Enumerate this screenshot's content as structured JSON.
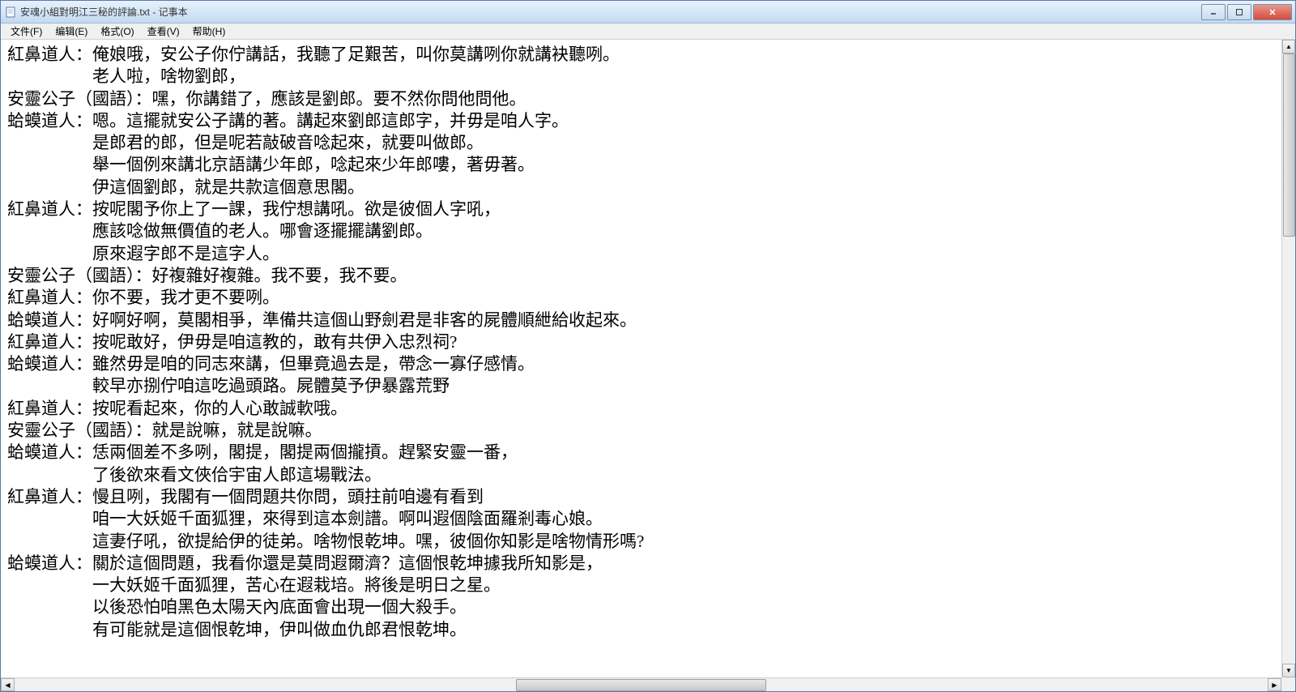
{
  "window": {
    "title": "安魂小組對明江三秘的評論.txt - 记事本"
  },
  "menu": {
    "file": "文件(F)",
    "edit": "编辑(E)",
    "format": "格式(O)",
    "view": "查看(V)",
    "help": "帮助(H)"
  },
  "content": "紅鼻道人：俺娘哦，安公子你佇講話，我聽了足艱苦，叫你莫講咧你就講袂聽咧。\n　　　　　老人啦，啥物劉郎，\n安靈公子（國語）：嘿，你講錯了，應該是劉郎。要不然你問他問他。\n蛤蟆道人：嗯。這擺就安公子講的著。講起來劉郎這郎字，并毋是咱人字。\n　　　　　是郎君的郎，但是呢若敲破音唸起來，就要叫做郎。\n　　　　　舉一個例來講北京語講少年郎，唸起來少年郎嘍，著毋著。\n　　　　　伊這個劉郎，就是共款這個意思閣。\n紅鼻道人：按呢閣予你上了一課，我佇想講吼。欲是彼個人字吼，\n　　　　　應該唸做無價值的老人。哪會逐擺擺講劉郎。\n　　　　　原來遐字郎不是這字人。\n安靈公子（國語）：好複雜好複雜。我不要，我不要。\n紅鼻道人：你不要，我才更不要咧。\n蛤蟆道人：好啊好啊，莫閣相爭，準備共這個山野劍君是非客的屍體順紲給收起來。\n紅鼻道人：按呢敢好，伊毋是咱這教的，敢有共伊入忠烈祠?\n蛤蟆道人：雖然毋是咱的同志來講，但畢竟過去是，帶念一寡仔感情。\n　　　　　較早亦捌佇咱這吃過頭路。屍體莫予伊暴露荒野\n紅鼻道人：按呢看起來，你的人心敢誠軟哦。\n安靈公子（國語）：就是說嘛，就是說嘛。\n蛤蟆道人：恁兩個差不多咧，閣提，閣提兩個攏摃。趕緊安靈一番，\n　　　　　了後欲來看文俠佮宇宙人郎這場戰法。\n紅鼻道人：慢且咧，我閣有一個問題共你問，頭拄前咱邊有看到\n　　　　　咱一大妖姬千面狐狸，來得到這本劍譜。啊叫遐個陰面羅剎毒心娘。\n　　　　　這妻仔吼，欲提給伊的徒弟。啥物恨乾坤。嘿，彼個你知影是啥物情形嗎?\n蛤蟆道人：關於這個問題，我看你還是莫問遐爾濟？這個恨乾坤據我所知影是，\n　　　　　一大妖姬千面狐狸，苦心在遐栽培。將後是明日之星。\n　　　　　以後恐怕咱黑色太陽天內底面會出現一個大殺手。\n　　　　　有可能就是這個恨乾坤，伊叫做血仇郎君恨乾坤。",
  "scrollbar": {
    "v_thumb_top": "0%",
    "v_thumb_height": "30%",
    "h_thumb_left": "40%",
    "h_thumb_width": "20%"
  }
}
